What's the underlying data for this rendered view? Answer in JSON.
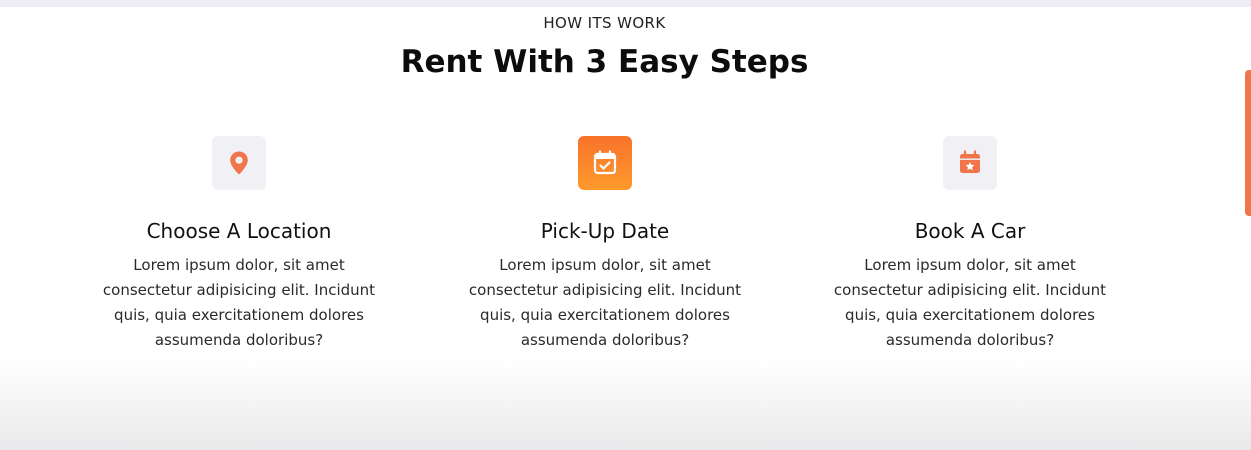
{
  "section": {
    "eyebrow": "HOW ITS WORK",
    "title": "Rent With 3 Easy Steps"
  },
  "steps": [
    {
      "icon": "location-pin-icon",
      "title": "Choose A Location",
      "description": "Lorem ipsum dolor, sit amet consectetur adipisicing elit. Incidunt quis, quia exercitationem dolores assumenda doloribus?",
      "active": false
    },
    {
      "icon": "calendar-check-icon",
      "title": "Pick-Up Date",
      "description": "Lorem ipsum dolor, sit amet consectetur adipisicing elit. Incidunt quis, quia exercitationem dolores assumenda doloribus?",
      "active": true
    },
    {
      "icon": "calendar-star-icon",
      "title": "Book A Car",
      "description": "Lorem ipsum dolor, sit amet consectetur adipisicing elit. Incidunt quis, quia exercitationem dolores assumenda doloribus?",
      "active": false
    }
  ],
  "colors": {
    "accent": "#f0754a",
    "accent_gradient_start": "#f9722b",
    "accent_gradient_end": "#ff9a2c",
    "icon_tile_bg": "#f1f1f5"
  }
}
